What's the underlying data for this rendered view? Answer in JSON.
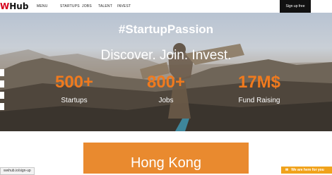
{
  "header": {
    "logo_w": "W",
    "logo_hub": "Hub",
    "nav": [
      "MENU",
      "STARTUPS",
      "JOBS",
      "TALENT",
      "INVEST"
    ],
    "signup_label": "Sign up free"
  },
  "hero": {
    "hashtag": "#StartupPassion",
    "tagline": "Discover. Join. Invest.",
    "stats": [
      {
        "value": "500+",
        "label": "Startups"
      },
      {
        "value": "800+",
        "label": "Jobs"
      },
      {
        "value": "17M$",
        "label": "Fund Raising"
      }
    ]
  },
  "card": {
    "title": "Hong Kong"
  },
  "status_url": "wwhub.io/sign-up",
  "chat_label": "We are here for you",
  "colors": {
    "accent": "#f07a1e",
    "brand_red": "#d6001c",
    "chat": "#f0a21b"
  }
}
